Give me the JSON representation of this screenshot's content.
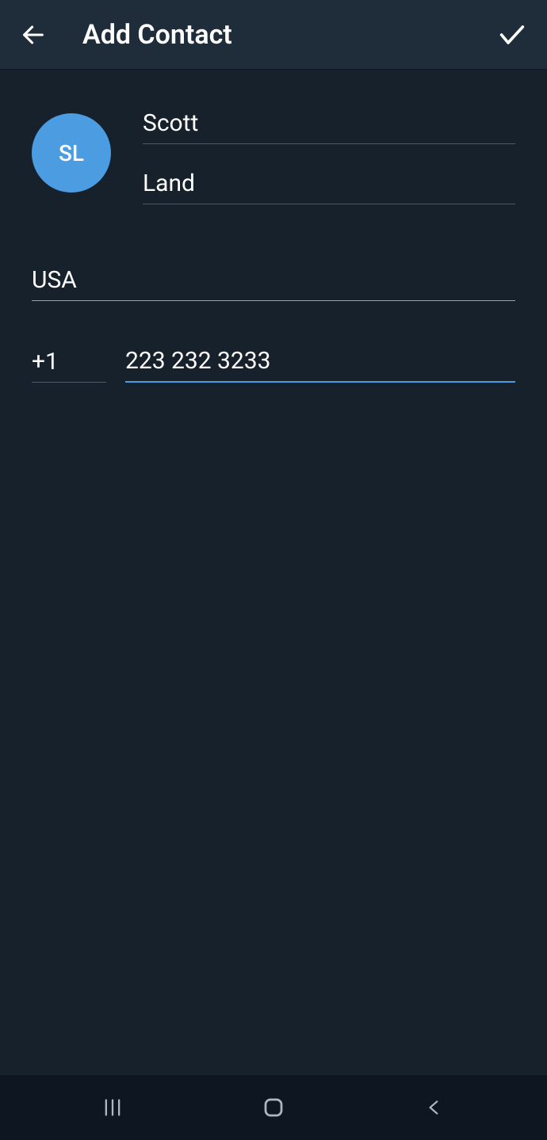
{
  "header": {
    "title": "Add Contact"
  },
  "contact": {
    "avatar_initials": "SL",
    "first_name": "Scott",
    "last_name": "Land",
    "country": "USA",
    "country_code": "+1",
    "phone": "223 232 3233"
  }
}
